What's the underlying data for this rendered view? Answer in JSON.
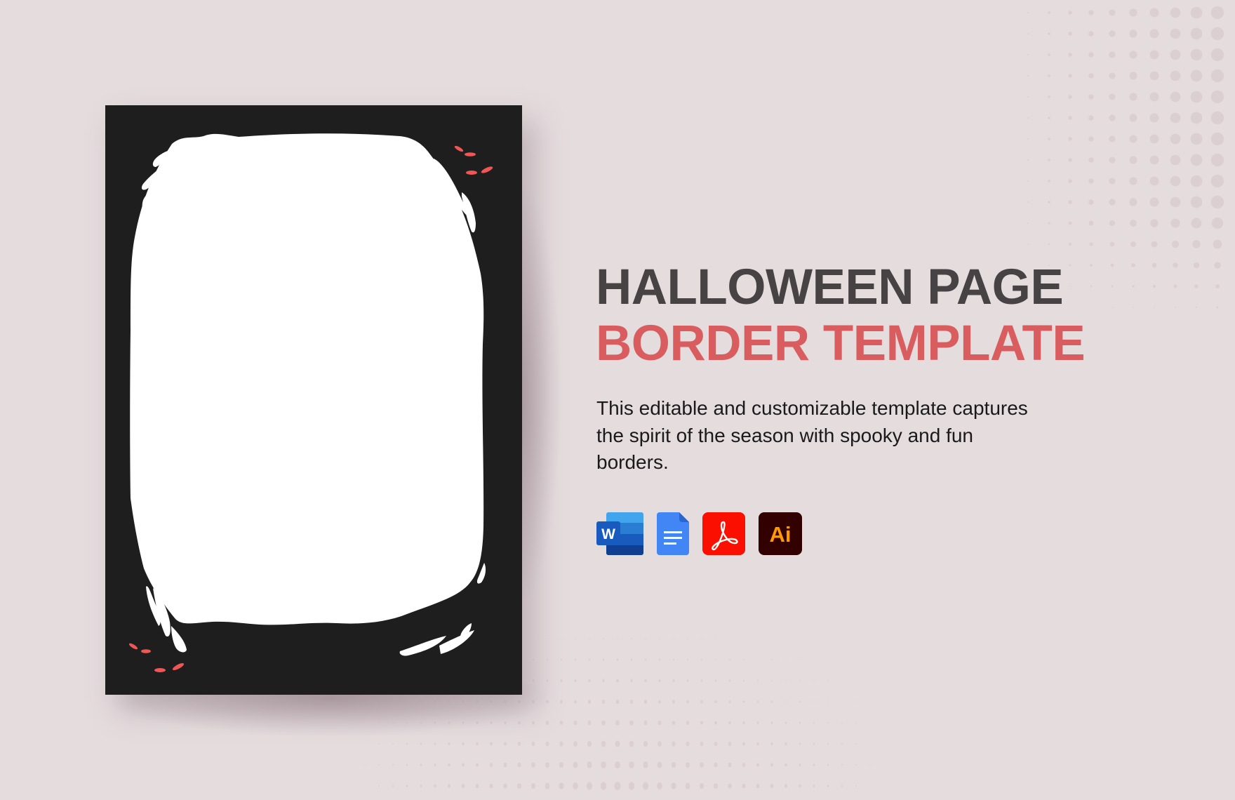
{
  "title": {
    "line1": "HALLOWEEN PAGE",
    "line2": "BORDER TEMPLATE"
  },
  "description": "This editable and customizable template captures the spirit of the season with spooky and fun borders.",
  "formats": [
    {
      "name": "Microsoft Word",
      "icon": "word-icon",
      "glyph": "W",
      "color": "#185abd"
    },
    {
      "name": "Google Docs",
      "icon": "google-docs-icon",
      "glyph": "",
      "color": "#4285f4"
    },
    {
      "name": "Adobe PDF",
      "icon": "adobe-pdf-icon",
      "glyph": "",
      "color": "#fa0f00"
    },
    {
      "name": "Adobe Illustrator",
      "icon": "adobe-illustrator-icon",
      "glyph": "Ai",
      "color": "#330000"
    }
  ],
  "colors": {
    "background": "#e5dcde",
    "title_dark": "#474344",
    "title_accent": "#d95d5f",
    "card": "#1e1e1e",
    "eyes": "#ef5656",
    "ai_text": "#ff9a00"
  }
}
